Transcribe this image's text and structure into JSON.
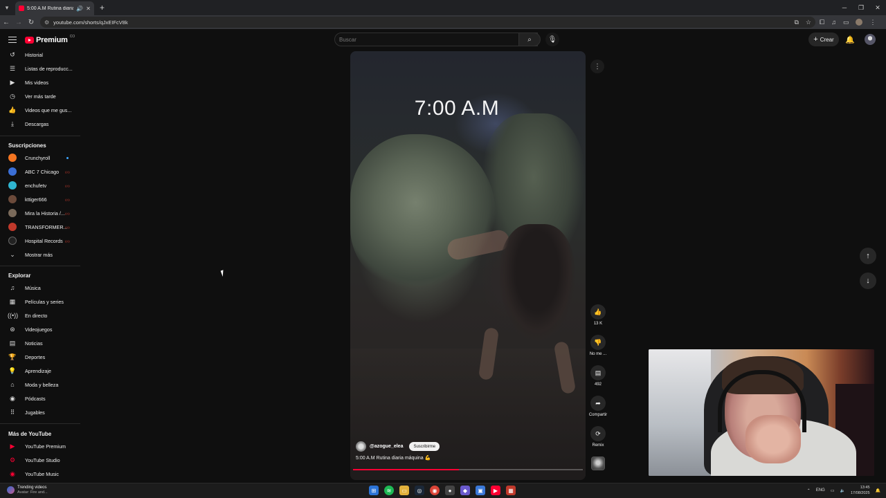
{
  "browser": {
    "tab_title": "5:00 A.M Rutina diaria máq",
    "url": "youtube.com/shorts/qJxEIFcV8k"
  },
  "header": {
    "logo_text": "Premium",
    "logo_suffix": "CO",
    "search_placeholder": "Buscar",
    "create_label": "Crear"
  },
  "sidebar": {
    "library": [
      {
        "label": "Historial",
        "icon": "history-icon"
      },
      {
        "label": "Listas de reproducc...",
        "icon": "playlist-icon"
      },
      {
        "label": "Mis videos",
        "icon": "my-videos-icon"
      },
      {
        "label": "Ver más tarde",
        "icon": "clock-icon"
      },
      {
        "label": "Videos que me gus...",
        "icon": "thumbs-up-icon"
      },
      {
        "label": "Descargas",
        "icon": "download-icon"
      }
    ],
    "subscriptions_heading": "Suscripciones",
    "subscriptions": [
      {
        "label": "Crunchyroll",
        "color": "#f47521",
        "badge": "dot"
      },
      {
        "label": "ABC 7 Chicago",
        "color": "#3b6fd6",
        "badge": "live"
      },
      {
        "label": "enchufetv",
        "color": "#2fb5d0",
        "badge": "live"
      },
      {
        "label": "kttiger666",
        "color": "#6b4a3a",
        "badge": "live"
      },
      {
        "label": "Mira la Historia /...",
        "color": "#7a6a5a",
        "badge": "live"
      },
      {
        "label": "TRANSFORMER...",
        "color": "#c0392b",
        "badge": "live"
      },
      {
        "label": "Hospital Records",
        "color": "#222222",
        "badge": "live"
      }
    ],
    "show_more": "Mostrar más",
    "explore_heading": "Explorar",
    "explore": [
      {
        "label": "Música",
        "icon": "music-icon"
      },
      {
        "label": "Películas y series",
        "icon": "movies-icon"
      },
      {
        "label": "En directo",
        "icon": "live-icon"
      },
      {
        "label": "Videojuegos",
        "icon": "gaming-icon"
      },
      {
        "label": "Noticias",
        "icon": "news-icon"
      },
      {
        "label": "Deportes",
        "icon": "trophy-icon"
      },
      {
        "label": "Aprendizaje",
        "icon": "lightbulb-icon"
      },
      {
        "label": "Moda y belleza",
        "icon": "hanger-icon"
      },
      {
        "label": "Pódcasts",
        "icon": "podcast-icon"
      },
      {
        "label": "Jugables",
        "icon": "grid-icon"
      }
    ],
    "more_heading": "Más de YouTube",
    "more": [
      {
        "label": "YouTube Premium"
      },
      {
        "label": "YouTube Studio"
      },
      {
        "label": "YouTube Music"
      }
    ]
  },
  "short": {
    "overlay_text": "7:00 A.M",
    "channel": "@azogue_elea",
    "subscribe_label": "Suscribirme",
    "caption": "5:00 A.M Rutina diaria máquina 💪",
    "progress_fraction": 0.46
  },
  "actions": {
    "likes": "13 K",
    "dislike_label": "No me ...",
    "comments": "492",
    "share_label": "Compartir",
    "remix_label": "Remix"
  },
  "taskbar": {
    "news_title": "Trending videos",
    "news_sub": "Avatar: Fire and...",
    "lang": "ENG",
    "time": "13:45",
    "date": "17/08/2025"
  }
}
